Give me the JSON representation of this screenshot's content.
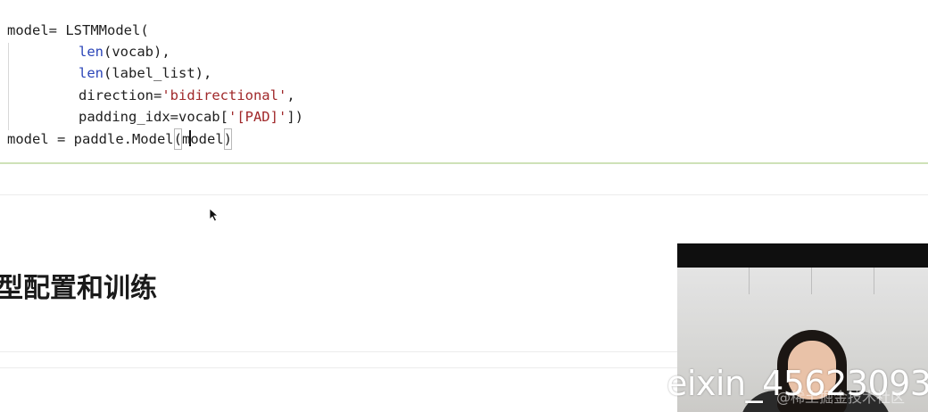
{
  "code_cell": {
    "line1": {
      "name": "model",
      "eq": "= ",
      "call": "LSTMModel("
    },
    "line2": {
      "fn": "len",
      "args": "(vocab),"
    },
    "line3": {
      "fn": "len",
      "args": "(label_list),"
    },
    "line4": {
      "key": "direction=",
      "value": "'bidirectional'",
      "tail": ","
    },
    "line5": {
      "key": "padding_idx=vocab[",
      "value": "'[PAD]'",
      "tail": "])"
    },
    "line6": {
      "prefix": "model = paddle.Model",
      "open_paren": "(",
      "arg_before_cursor": "m",
      "arg_after_cursor": "odel",
      "close_paren": ")"
    }
  },
  "heading": {
    "text": "型配置和训练"
  },
  "video_overlay": {
    "watermark": "eixin_45623093",
    "watermark_sub": "@稀土掘金技术社区"
  },
  "colors": {
    "builtin": "#2b45b8",
    "string": "#a0282a",
    "cell_separator": "#cfe2b8"
  }
}
